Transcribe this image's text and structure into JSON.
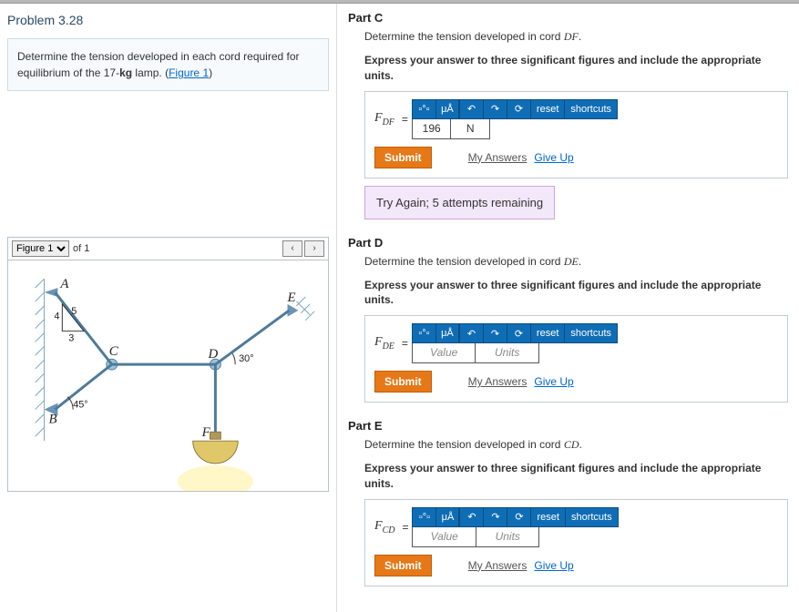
{
  "problem": {
    "title": "Problem 3.28",
    "text_before": "Determine the tension developed in each cord required for equilibrium of the 17-",
    "bold_kg": "kg",
    "text_after": " lamp. (",
    "figure_link": "Figure 1",
    "text_end": ")"
  },
  "figure": {
    "selected": "Figure 1",
    "of_text": "of 1",
    "nav_prev": "‹",
    "nav_next": "›",
    "labels": {
      "A": "A",
      "B": "B",
      "C": "C",
      "D": "D",
      "E": "E",
      "F": "F",
      "ang_45": "45°",
      "ang_30": "30°",
      "r4": "4",
      "r5": "5",
      "r3": "3"
    }
  },
  "parts": {
    "C": {
      "title": "Part C",
      "prompt_pre": "Determine the tension developed in cord ",
      "prompt_var": "DF",
      "prompt_post": ".",
      "details": "Express your answer to three significant figures and include the appropriate units.",
      "label_base": "F",
      "label_sub": "DF",
      "eq": "=",
      "value": "196",
      "units": "N",
      "submit": "Submit",
      "my_answers": "My Answers",
      "give_up": "Give Up",
      "feedback": "Try Again; 5 attempts remaining"
    },
    "D": {
      "title": "Part D",
      "prompt_pre": "Determine the tension developed in cord ",
      "prompt_var": "DE",
      "prompt_post": ".",
      "details": "Express your answer to three significant figures and include the appropriate units.",
      "label_base": "F",
      "label_sub": "DE",
      "eq": "=",
      "value_ph": "Value",
      "units_ph": "Units",
      "submit": "Submit",
      "my_answers": "My Answers",
      "give_up": "Give Up"
    },
    "E": {
      "title": "Part E",
      "prompt_pre": "Determine the tension developed in cord ",
      "prompt_var": "CD",
      "prompt_post": ".",
      "details": "Express your answer to three significant figures and include the appropriate units.",
      "label_base": "F",
      "label_sub": "CD",
      "eq": "=",
      "value_ph": "Value",
      "units_ph": "Units",
      "submit": "Submit",
      "my_answers": "My Answers",
      "give_up": "Give Up"
    }
  },
  "toolbar": {
    "fmt": "▫°▫",
    "mu": "μÅ",
    "undo": "↶",
    "redo": "↷",
    "reset_icon": "⟳",
    "reset": "reset",
    "shortcuts": "shortcuts"
  }
}
